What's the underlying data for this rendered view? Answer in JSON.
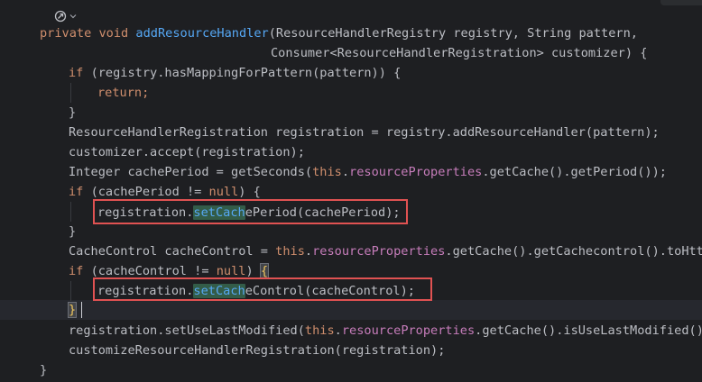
{
  "editor": {
    "gutter_icons": {
      "method_icon": "interface-implementation-icon",
      "chevron": "chevron-down-icon"
    },
    "lines": {
      "l1_modifiers": "private void ",
      "l1_name": "addResourceHandler",
      "l1_params": "(ResourceHandlerRegistry registry, String pattern,",
      "l2": "Consumer<ResourceHandlerRegistration> customizer) {",
      "l3_if": "if ",
      "l3_rest": "(registry.hasMappingForPattern(pattern)) {",
      "l4_return": "return",
      "l4_semi": ";",
      "l5": "}",
      "l6": "ResourceHandlerRegistration registration = registry.addResourceHandler(pattern);",
      "l7": "customizer.accept(registration);",
      "l8_a": "Integer cachePeriod = getSeconds(",
      "l8_this": "this",
      "l8_dot": ".",
      "l8_field": "resourceProperties",
      "l8_rest": ".getCache().getPeriod());",
      "l9_if": "if ",
      "l9_a": "(cachePeriod != ",
      "l9_null": "null",
      "l9_b": ") {",
      "l10_a": "registration.",
      "l10_match": "setCach",
      "l10_b": "ePeriod(cachePeriod);",
      "l11": "}",
      "l12_a": "CacheControl cacheControl = ",
      "l12_this": "this",
      "l12_dot": ".",
      "l12_field": "resourceProperties",
      "l12_rest": ".getCache().getCachecontrol().toHttpCa",
      "l13_if": "if ",
      "l13_a": "(cacheControl != ",
      "l13_null": "null",
      "l13_b": ") ",
      "l13_brace": "{",
      "l14_a": "registration.",
      "l14_match": "setCach",
      "l14_b": "eControl(cacheControl);",
      "l15_brace": "}",
      "l16_a": "registration.setUseLastModified(",
      "l16_this": "this",
      "l16_dot": ".",
      "l16_field": "resourceProperties",
      "l16_rest": ".getCache().isUseLastModified());",
      "l17": "customizeResourceHandlerRegistration(registration);",
      "l18": "}"
    }
  },
  "colors": {
    "background": "#1e1f22",
    "keyword": "#cf8e6d",
    "method_declaration": "#56a8f5",
    "field": "#c77dbb",
    "plain": "#bcbec4",
    "highlight_box": "#e05252",
    "search_match": "#335c48"
  }
}
